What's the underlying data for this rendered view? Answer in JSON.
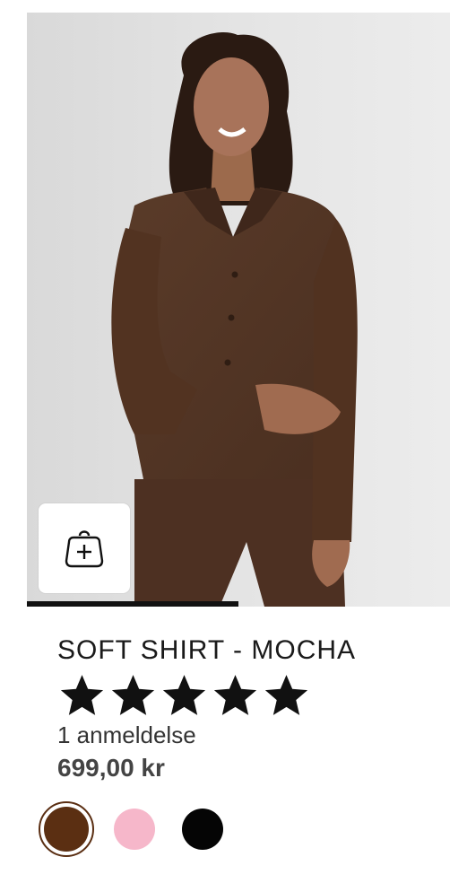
{
  "product": {
    "title": "SOFT SHIRT - MOCHA",
    "rating": 5,
    "rating_max": 5,
    "review_text": "1 anmeldelse",
    "price": "699,00 kr"
  },
  "gallery": {
    "progress": 0.5
  },
  "swatches": [
    {
      "name": "mocha",
      "color": "#5b2f12",
      "selected": true
    },
    {
      "name": "pink",
      "color": "#f6b7ca",
      "selected": false
    },
    {
      "name": "black",
      "color": "#050505",
      "selected": false
    }
  ],
  "icons": {
    "add_to_bag": "bag-plus-icon",
    "star": "star-icon"
  }
}
